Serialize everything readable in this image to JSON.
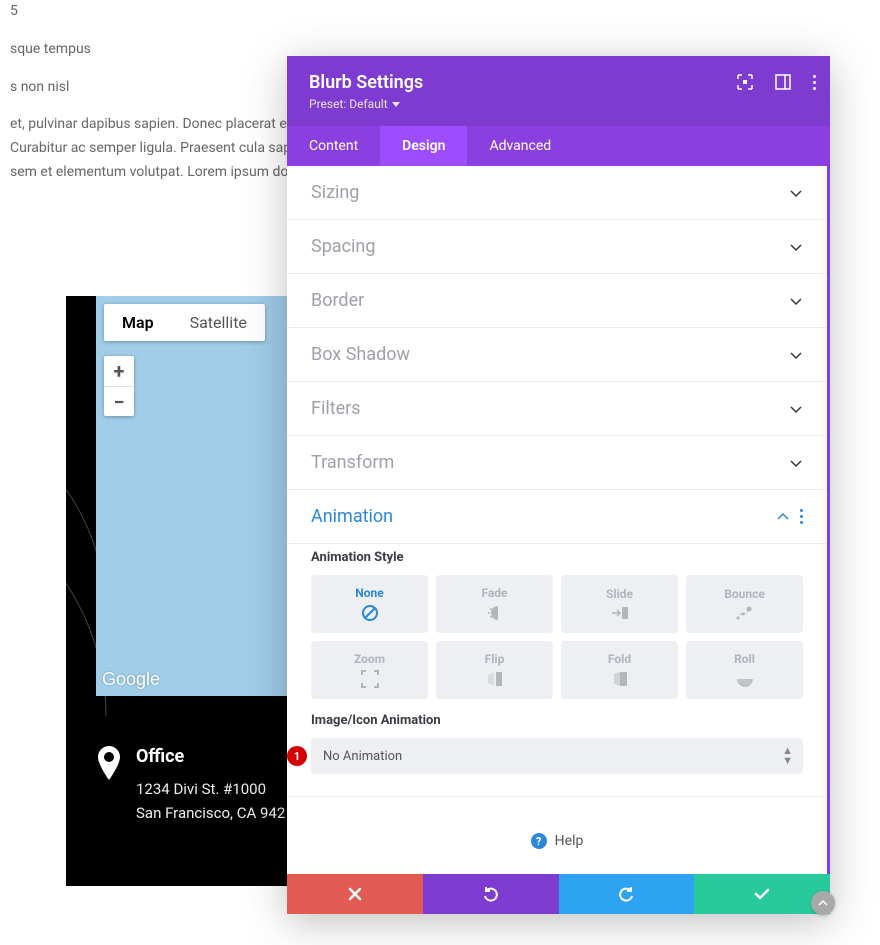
{
  "bg": {
    "frag1": "5",
    "frag2": "sque tempus",
    "frag3": "s non nisl",
    "para": "et, pulvinar dapibus sapien. Donec placerat erat o tempus et. Curabitur ac semper ligula. Praesent cula sapien. Donec euismod, sem et elementum volutpat. Lorem ipsum dolor sit amet, consectetu"
  },
  "map": {
    "types": {
      "map": "Map",
      "satellite": "Satellite"
    },
    "google": "Google",
    "office": {
      "heading": "Office",
      "line1": "1234 Divi St. #1000",
      "line2": "San Francisco, CA 942"
    }
  },
  "modal": {
    "title": "Blurb Settings",
    "preset": "Preset: Default",
    "tabs": {
      "content": "Content",
      "design": "Design",
      "advanced": "Advanced"
    },
    "sections": {
      "sizing": "Sizing",
      "spacing": "Spacing",
      "border": "Border",
      "boxshadow": "Box Shadow",
      "filters": "Filters",
      "transform": "Transform",
      "animation": "Animation"
    },
    "animation": {
      "style_label": "Animation Style",
      "opts": {
        "none": "None",
        "fade": "Fade",
        "slide": "Slide",
        "bounce": "Bounce",
        "zoom": "Zoom",
        "flip": "Flip",
        "fold": "Fold",
        "roll": "Roll"
      },
      "image_label": "Image/Icon Animation",
      "select_value": "No Animation",
      "badge": "1"
    },
    "help": "Help"
  }
}
